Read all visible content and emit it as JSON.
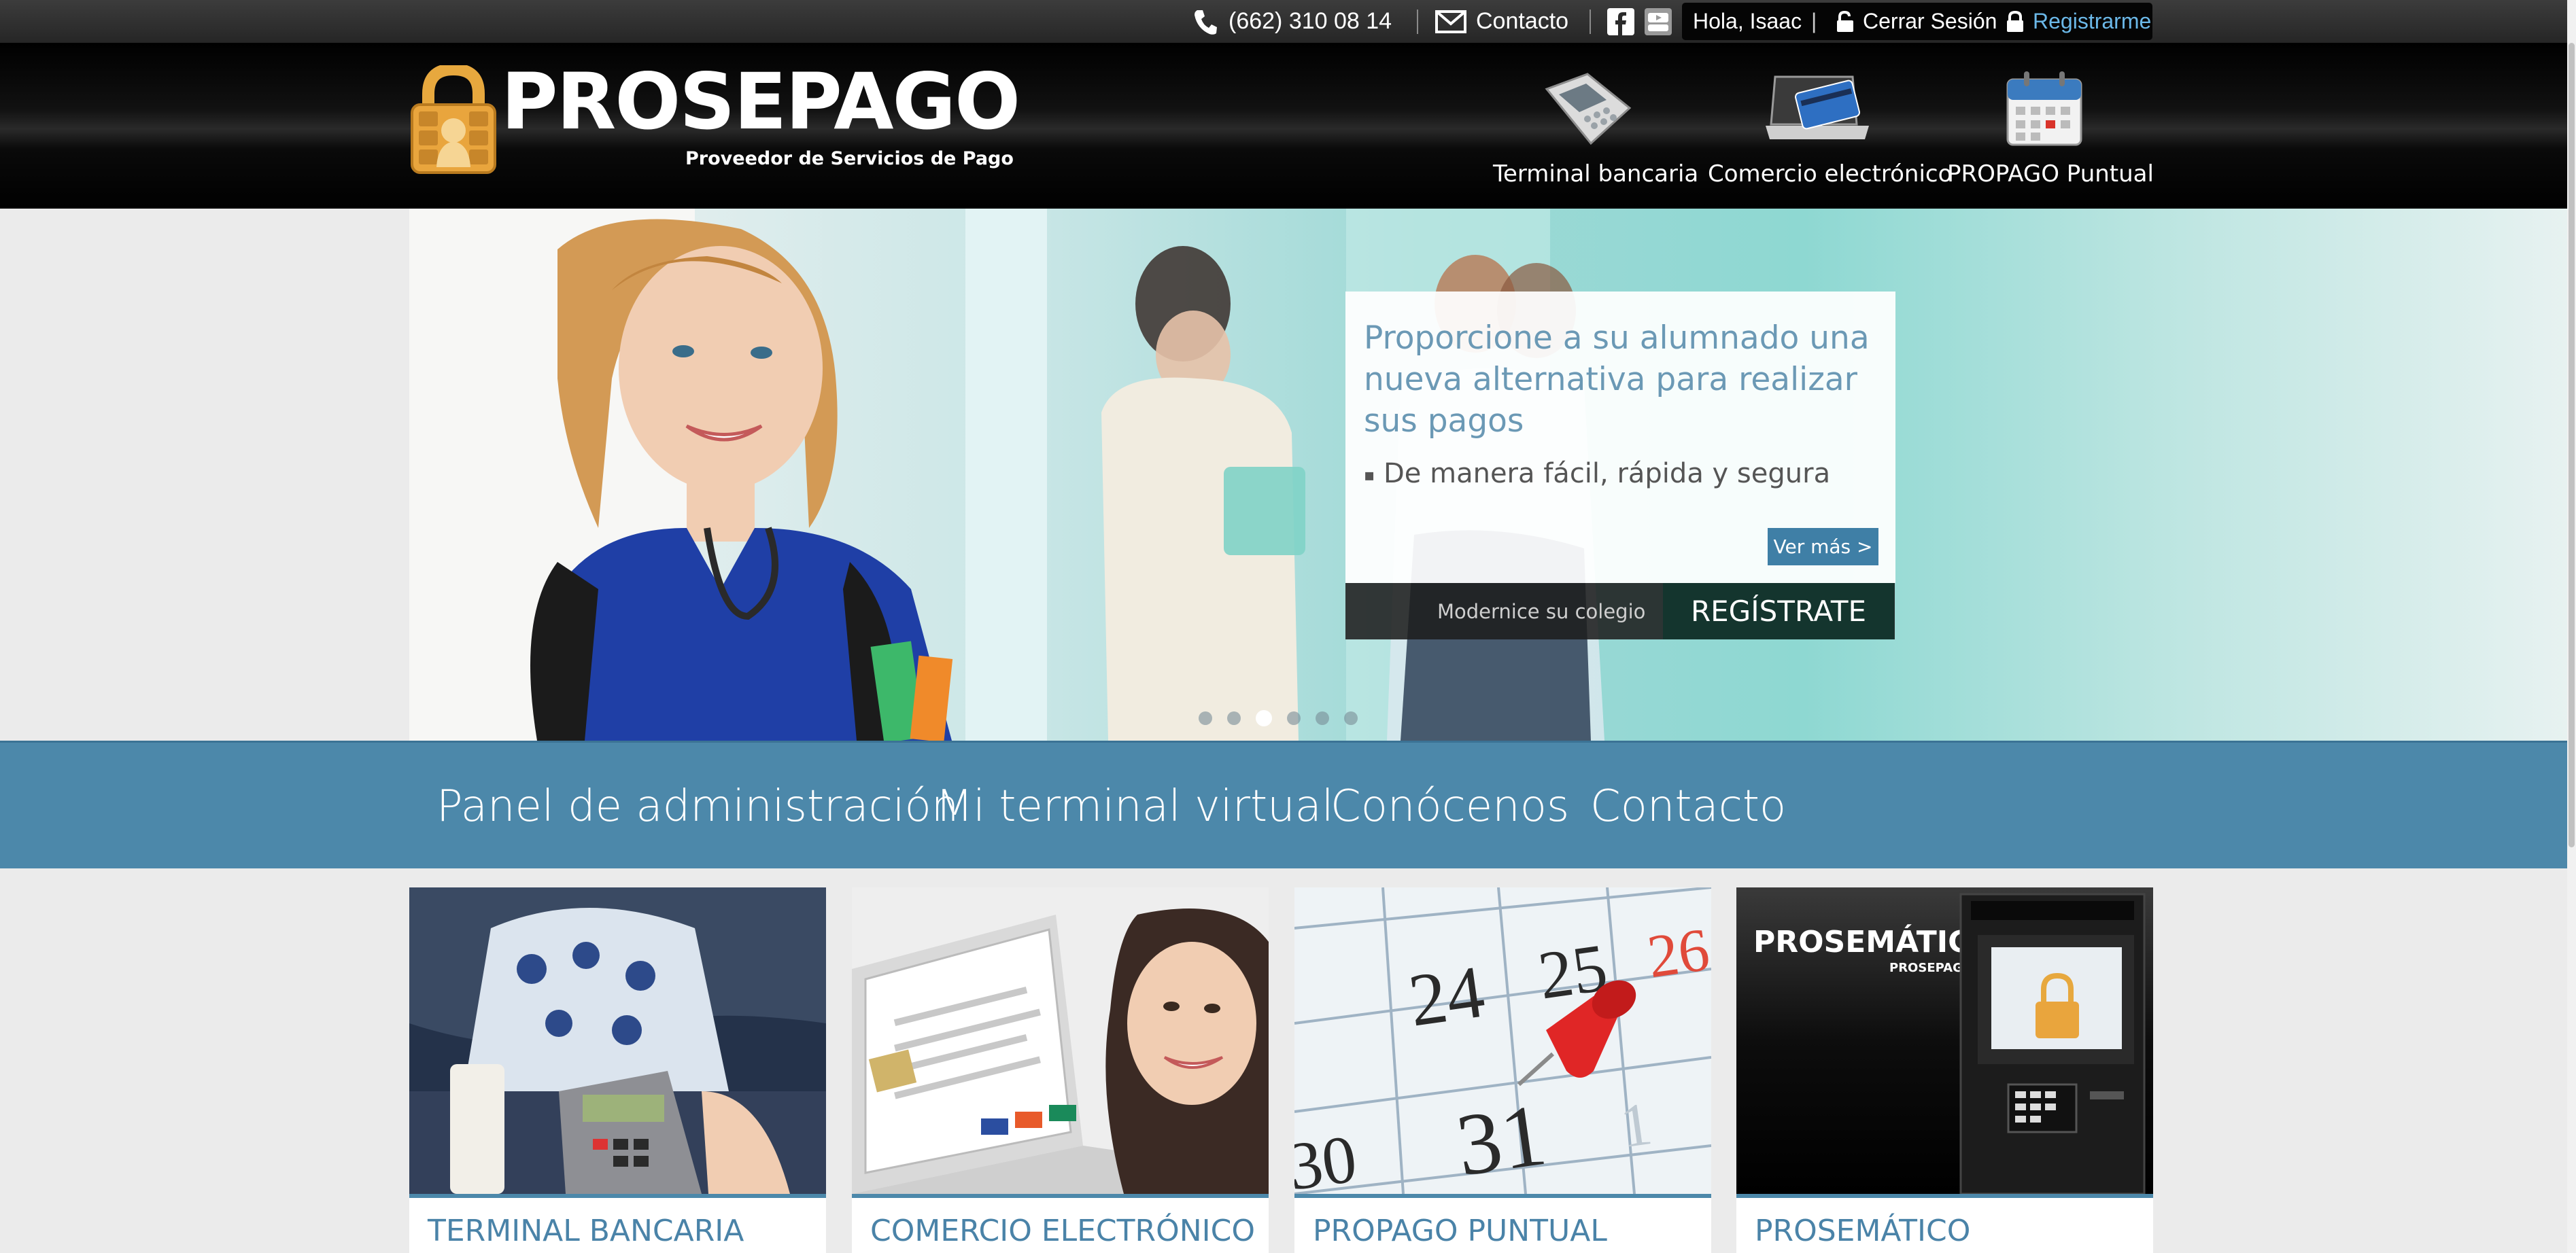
{
  "topbar": {
    "phone": "(662) 310 08 14",
    "contact": "Contacto",
    "greeting": "Hola, Isaac",
    "divider": "|",
    "logout": "Cerrar Sesión",
    "register": "Registrarme",
    "icons": [
      "phone-icon",
      "mail-icon",
      "facebook-icon",
      "youtube-icon",
      "lock-icon"
    ]
  },
  "header": {
    "logo_text": "PROSEPAGO",
    "logo_subtitle": "Proveedor de Servicios de Pago",
    "nav": [
      {
        "label": "Terminal bancaria",
        "icon": "card-terminal-icon"
      },
      {
        "label": "Comercio electrónico",
        "icon": "laptop-card-icon"
      },
      {
        "label": "PROPAGO Puntual",
        "icon": "calendar-icon"
      }
    ]
  },
  "hero": {
    "headline": "Proporcione a su alumnado una nueva alternativa para realizar sus pagos",
    "bullet_marker": "▪",
    "bullet": "De manera fácil, rápida y segura",
    "cta_more": "Ver más >",
    "tagline": "Modernice su colegio",
    "cta_register": "REGÍSTRATE",
    "slide_count": 6,
    "active_slide": 3
  },
  "main_nav": [
    "Panel de administración",
    "Mi terminal virtual",
    "Conócenos",
    "Contacto"
  ],
  "cards": [
    {
      "title": "TERMINAL BANCARIA"
    },
    {
      "title": "COMERCIO ELECTRÓNICO"
    },
    {
      "title": "PROPAGO PUNTUAL"
    },
    {
      "title": "PROSEMÁTICO",
      "image_heading": "PROSEMÁTICO",
      "image_brand": "PROSEPAGO"
    }
  ],
  "colors": {
    "accent_blue": "#4c88aa",
    "link_blue": "#6bb8e8",
    "cta_dark": "#14352e"
  }
}
